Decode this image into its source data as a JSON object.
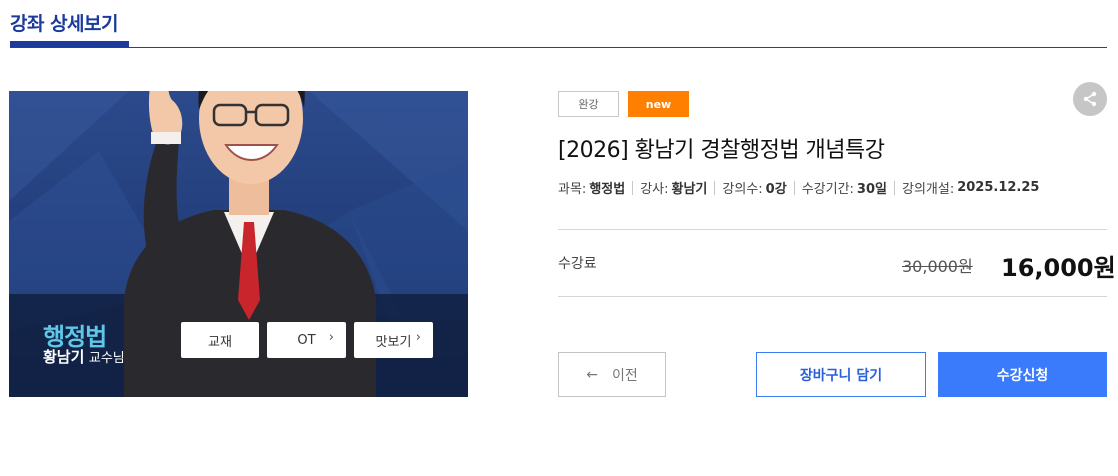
{
  "page": {
    "heading": "강좌 상세보기"
  },
  "banner": {
    "subject": "행정법",
    "instructor_name": "황남기",
    "instructor_suffix": "교수님",
    "buttons": [
      {
        "label": "교재",
        "chevron": ""
      },
      {
        "label": "OT",
        "chevron": "›"
      },
      {
        "label": "맛보기",
        "chevron": "›"
      }
    ]
  },
  "badges": {
    "status": "완강",
    "new": "new"
  },
  "course": {
    "title": "[2026] 황남기 경찰행정법 개념특강",
    "meta": [
      {
        "label": "과목:",
        "value": "행정법"
      },
      {
        "label": "강사:",
        "value": "황남기"
      },
      {
        "label": "강의수:",
        "value": "0강"
      },
      {
        "label": "수강기간:",
        "value": "30일"
      },
      {
        "label": "강의개설:",
        "value": "2025.12.25"
      }
    ]
  },
  "pricing": {
    "label": "수강료",
    "original": "30,000원",
    "sale": "16,000원"
  },
  "actions": {
    "prev_arrow": "←",
    "prev_label": "이전",
    "cart_label": "장바구니 담기",
    "enroll_label": "수강신청"
  },
  "icons": {
    "share": "share-icon",
    "prev": "arrow-left-icon",
    "chevron": "chevron-right-icon"
  },
  "colors": {
    "brand": "#1c3a9c",
    "accent_blue": "#3a7bfb",
    "badge_new": "#ff7f00",
    "subject_cyan": "#5fc8e8"
  }
}
